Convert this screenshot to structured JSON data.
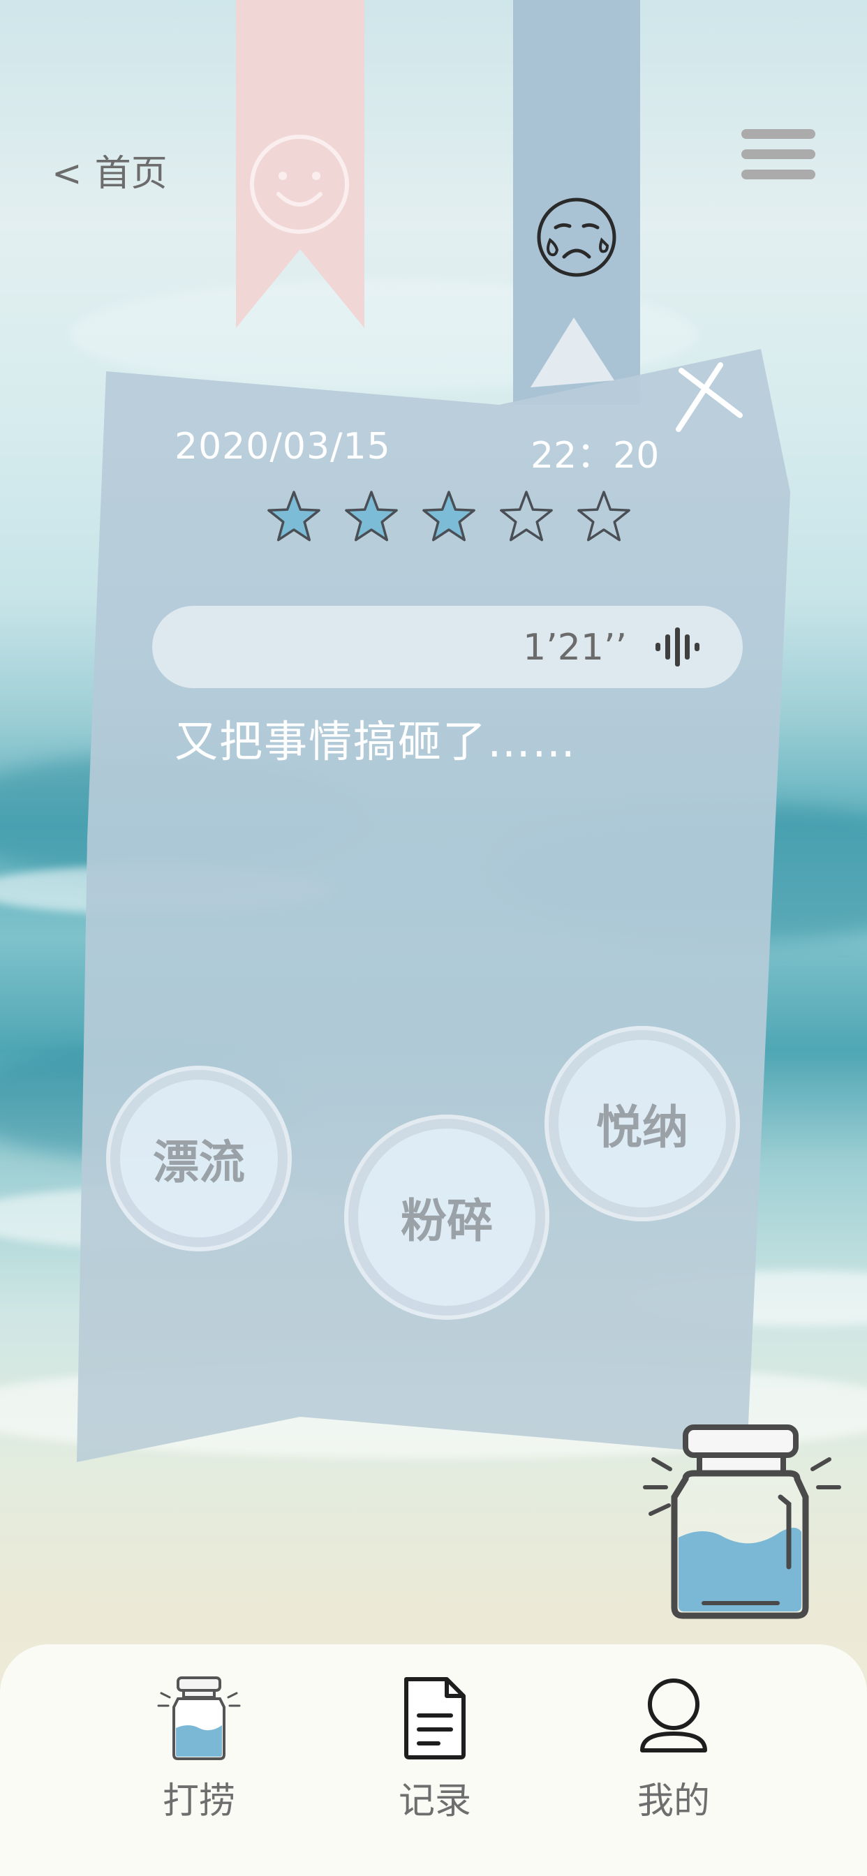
{
  "nav": {
    "back_chevron": "<",
    "back_label": "首页"
  },
  "entry": {
    "date": "2020/03/15",
    "time": "22：20",
    "rating": 3,
    "rating_max": 5,
    "voice_duration": "1’21’’",
    "note": "又把事情搞砸了……"
  },
  "actions": {
    "drift": "漂流",
    "crush": "粉碎",
    "accept": "悦纳"
  },
  "tabbar": {
    "salvage": "打捞",
    "records": "记录",
    "mine": "我的"
  },
  "colors": {
    "star_filled": "#7dbcd7",
    "ribbon_pink": "#f1d6d6",
    "ribbon_blue": "#a9c3d5",
    "card": "#b8ccd9",
    "jar_water": "#7ab8d6"
  }
}
